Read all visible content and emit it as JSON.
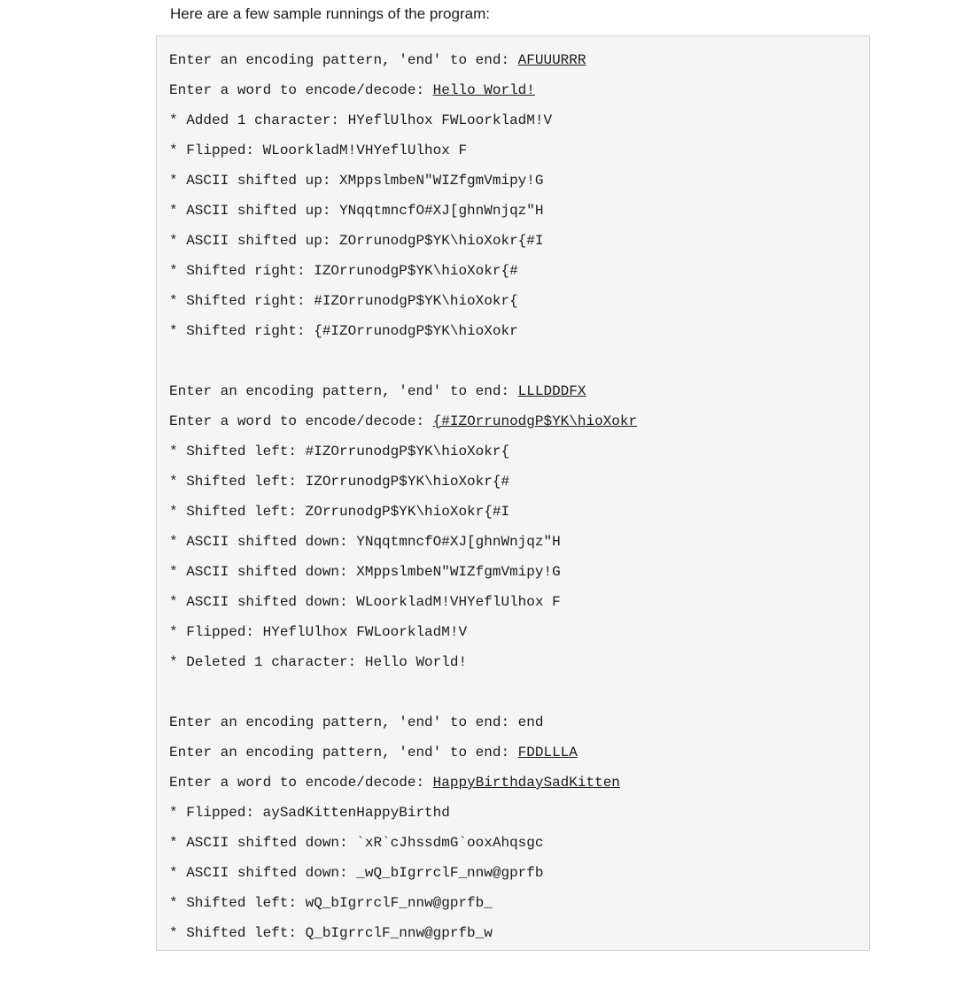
{
  "intro": "Here are a few sample runnings of the program:",
  "runs": [
    {
      "prompt1_prefix": "Enter an encoding pattern, 'end' to end: ",
      "prompt1_input": "AFUUURRR",
      "prompt2_prefix": "Enter a word to encode/decode: ",
      "prompt2_input": "Hello World!",
      "output": [
        "* Added 1 character: HYeflUlhox FWLoorkladM!V",
        "* Flipped: WLoorkladM!VHYeflUlhox F",
        "* ASCII shifted up: XMppslmbeN\"WIZfgmVmipy!G",
        "* ASCII shifted up: YNqqtmncfO#XJ[ghnWnjqz\"H",
        "* ASCII shifted up: ZOrrunodgP$YK\\hioXokr{#I",
        "* Shifted right: IZOrrunodgP$YK\\hioXokr{#",
        "* Shifted right: #IZOrrunodgP$YK\\hioXokr{",
        "* Shifted right: {#IZOrrunodgP$YK\\hioXokr"
      ]
    },
    {
      "prompt1_prefix": "Enter an encoding pattern, 'end' to end: ",
      "prompt1_input": "LLLDDDFX",
      "prompt2_prefix": "Enter a word to encode/decode: ",
      "prompt2_input": "{#IZOrrunodgP$YK\\hioXokr",
      "output": [
        "* Shifted left: #IZOrrunodgP$YK\\hioXokr{",
        "* Shifted left: IZOrrunodgP$YK\\hioXokr{#",
        "* Shifted left: ZOrrunodgP$YK\\hioXokr{#I",
        "* ASCII shifted down: YNqqtmncfO#XJ[ghnWnjqz\"H",
        "* ASCII shifted down: XMppslmbeN\"WIZfgmVmipy!G",
        "* ASCII shifted down: WLoorkladM!VHYeflUlhox F",
        "* Flipped: HYeflUlhox FWLoorkladM!V",
        "* Deleted 1 character: Hello World!"
      ]
    },
    {
      "preline": "Enter an encoding pattern, 'end' to end: end",
      "prompt1_prefix": "Enter an encoding pattern, 'end' to end: ",
      "prompt1_input": "FDDLLLA",
      "prompt2_prefix": "Enter a word to encode/decode: ",
      "prompt2_input": "HappyBirthdaySadKitten",
      "output": [
        "* Flipped: aySadKittenHappyBirthd",
        "* ASCII shifted down: `xR`cJhssdmG`ooxAhqsgc",
        "* ASCII shifted down: _wQ_bIgrrclF_nnw@gprfb",
        "* Shifted left: wQ_bIgrrclF_nnw@gprfb_",
        "* Shifted left: Q_bIgrrclF_nnw@gprfb_w"
      ]
    }
  ]
}
